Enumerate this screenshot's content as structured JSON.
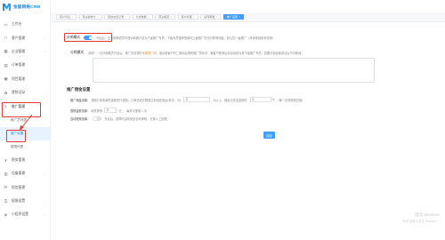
{
  "app": {
    "logo_text": "金鼠网络CRM"
  },
  "sidebar": {
    "items": [
      {
        "label": "工作台",
        "icon": "monitor-icon"
      },
      {
        "label": "客户管理",
        "icon": "user-icon"
      },
      {
        "label": "企业管理",
        "icon": "building-icon"
      },
      {
        "label": "订单管理",
        "icon": "order-icon"
      },
      {
        "label": "项目管理",
        "icon": "grid-icon"
      },
      {
        "label": "营销活动",
        "icon": "gift-icon"
      },
      {
        "label": "推广管理",
        "icon": "share-icon"
      }
    ],
    "sub_items": [
      {
        "label": "推广员列表"
      },
      {
        "label": "推广设置"
      },
      {
        "label": "提现列表"
      }
    ],
    "items_after": [
      {
        "label": "财务管理",
        "icon": "finance-icon"
      },
      {
        "label": "设备管理",
        "icon": "device-icon"
      },
      {
        "label": "短信管理",
        "icon": "sms-icon"
      },
      {
        "label": "权限设置",
        "icon": "key-icon"
      },
      {
        "label": "小程序设置",
        "icon": "mini-icon"
      }
    ]
  },
  "tabs": [
    {
      "label": "客户列表"
    },
    {
      "label": "营业额统计"
    },
    {
      "label": "短信充值记录"
    },
    {
      "label": "分析数据"
    },
    {
      "label": "营业额度"
    },
    {
      "label": "客户管理"
    },
    {
      "label": "提现明细"
    },
    {
      "label": "推广设置",
      "active": true
    }
  ],
  "settings": {
    "distribution_switch_label": "分销模式",
    "distribution_switch_desc": "开启后，企业推荐成员可邀请新客户成为下级推广专员，下级专员推荐签单时上级推广员也可获得佣金，默认仅一级推广（具体规则参考说明）",
    "mode_label": "分销模式",
    "mode_desc_prefix": "说明：一旦分销模式开启后，推广员自带的",
    "mode_desc_highlight": "专属推广码",
    "mode_desc_suffix": "，邀请新客户时二维码会带有推广员标识，新客户登录后将自动成为其下级推广专员，如果分销设置成功后不可取消。",
    "agent_section_title": "推广佣金设置",
    "commission_row_label": "推广佣金设置：",
    "commission_row_text": "按照订单收款的金额进行奖励，订单总成交额需达到设定值后(单位：元)",
    "commission_input_value": "0",
    "commission_unit": "元以上，佣金占成交金额的",
    "commission_rate_value": "0",
    "commission_rate_unit": "%",
    "commission_note": "（第一次提现需交纳）",
    "withdraw_label": "提现金额设置：",
    "withdraw_text": "最低提现",
    "withdraw_value": "0",
    "withdraw_unit": "元",
    "withdraw_extra": "每月可提现 1 次",
    "auto_label": "自动提现设置：",
    "auto_desc": "开启后，提现时由系统全自动审核，无需人工处理。",
    "save_button": "保存"
  },
  "watermark": {
    "line1": "激活 Windows",
    "line2": "转到“设置”以激活 Windows。"
  }
}
